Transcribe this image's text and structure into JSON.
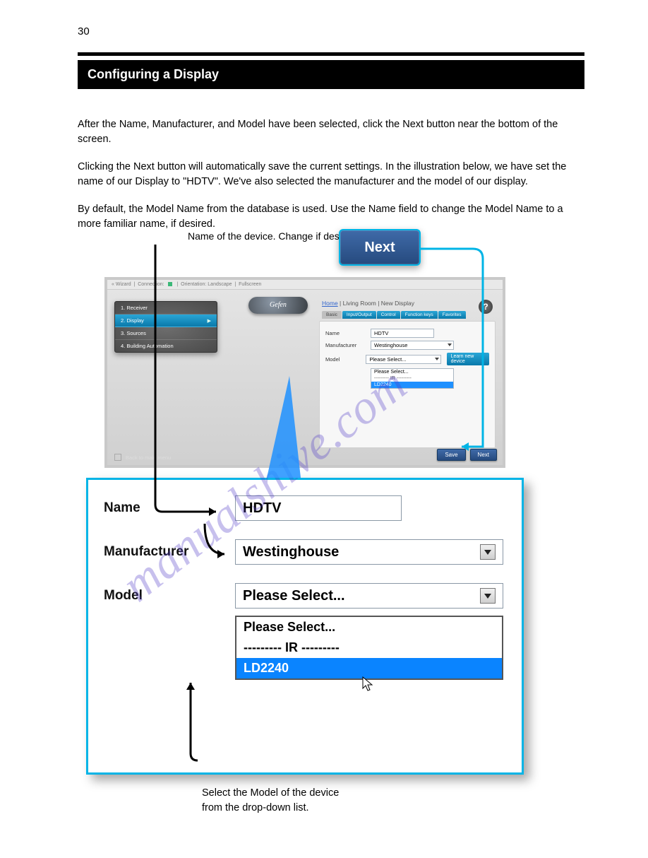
{
  "page_number": "30",
  "black_header": "Configuring a Display",
  "intro_paragraphs": [
    "After the Name, Manufacturer, and Model have been selected, click the Next button near the bottom of the screen.",
    "Clicking the Next button will automatically save the current settings.   In the illustration below, we have set the name of our Display to \"HDTV\".   We've also selected the manufacturer and the model of our display.",
    "By default, the Model Name from the database is used.   Use the Name field to change the Model Name to a more familiar name, if desired."
  ],
  "callouts": {
    "name_label": "Name of the device.    Change if desired.",
    "next_chip": "Next"
  },
  "mini": {
    "topbar": {
      "wizard": "« Wizard",
      "connection": "Connection:",
      "orient": "Orientation: Landscape",
      "full": "Fullscreen"
    },
    "logo": "Gefen",
    "side_items": [
      {
        "label": "1. Receiver"
      },
      {
        "label": "2. Display",
        "active": true,
        "arrow": true
      },
      {
        "label": "3. Sources"
      },
      {
        "label": "4. Building Automation"
      }
    ],
    "back": "Back to main menu",
    "breadcrumb": {
      "home": "Home",
      "rest": " | Living Room | New Display"
    },
    "tabs": [
      "Basic",
      "Input/Output",
      "Control",
      "Function keys",
      "Favorites"
    ],
    "help_icon": "?",
    "form": {
      "name_label": "Name",
      "name_value": "HDTV",
      "manu_label": "Manufacturer",
      "manu_value": "Westinghouse",
      "model_label": "Model",
      "model_value": "Please Select...",
      "learn_btn": "Learn new device",
      "options": {
        "p0": "Please Select...",
        "p1": "--------- IR ---------",
        "p2": "LD2240"
      }
    },
    "footer": {
      "save": "Save",
      "next": "Next"
    }
  },
  "zoom": {
    "name_label": "Name",
    "name_value": "HDTV",
    "manu_label": "Manufacturer",
    "manu_value": "Westinghouse",
    "model_label": "Model",
    "model_value": "Please Select...",
    "list": {
      "p0": "Please Select...",
      "p1": "--------- IR ---------",
      "p2": "LD2240"
    }
  },
  "bottom_annotation": {
    "l1": "Select the Model of the device",
    "l2": "from the drop-down list."
  },
  "watermark": "manualshive.com"
}
